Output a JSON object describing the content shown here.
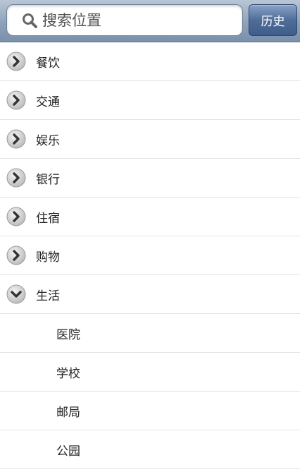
{
  "search": {
    "placeholder": "搜索位置",
    "history_label": "历史"
  },
  "categories": [
    {
      "label": "餐饮",
      "expanded": false
    },
    {
      "label": "交通",
      "expanded": false
    },
    {
      "label": "娱乐",
      "expanded": false
    },
    {
      "label": "银行",
      "expanded": false
    },
    {
      "label": "住宿",
      "expanded": false
    },
    {
      "label": "购物",
      "expanded": false
    },
    {
      "label": "生活",
      "expanded": true
    }
  ],
  "subcategories": [
    {
      "label": "医院"
    },
    {
      "label": "学校"
    },
    {
      "label": "邮局"
    },
    {
      "label": "公园"
    }
  ]
}
